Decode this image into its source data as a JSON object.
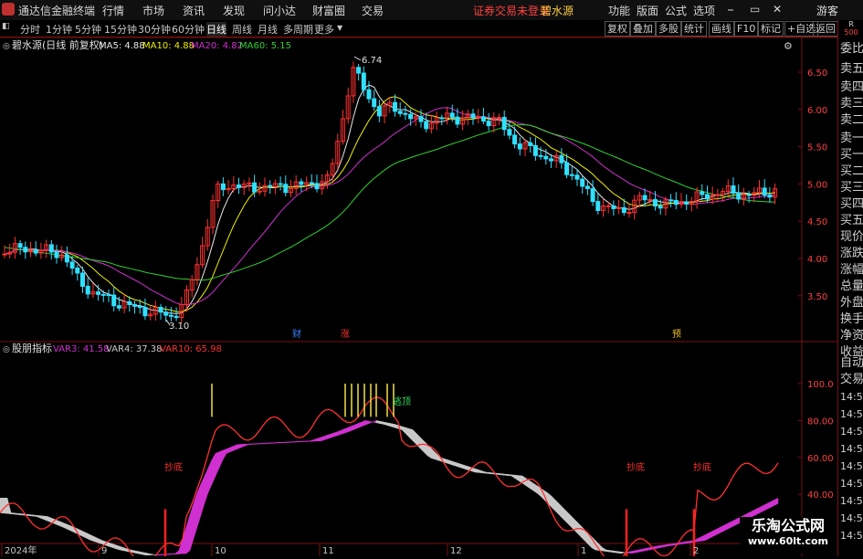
{
  "menubar": {
    "app_title": "通达信金融终端",
    "menus": [
      "行情",
      "市场",
      "资讯",
      "发现",
      "问小达",
      "财富圈",
      "交易"
    ],
    "notice": "证券交易未登录",
    "stock_name": "碧水源",
    "right_menus": [
      "功能",
      "版面",
      "公式",
      "选项"
    ],
    "window_controls": [
      "minimize-icon",
      "restore-icon",
      "close-icon"
    ],
    "guest_label": "游客"
  },
  "toolbar": {
    "periods": [
      "分时",
      "1分钟",
      "5分钟",
      "15分钟",
      "30分钟",
      "60分钟",
      "日线",
      "周线",
      "月线",
      "多周期",
      "更多"
    ],
    "active_period": "日线",
    "right_buttons": [
      "复权",
      "叠加",
      "多股",
      "统计",
      "画线",
      "F10",
      "标记",
      "+自选",
      "返回"
    ]
  },
  "side_panel": {
    "badge_top": "R",
    "badge_num": "500",
    "labels": [
      "委比",
      "卖五",
      "卖四",
      "卖三",
      "卖二",
      "卖一",
      "买一",
      "买二",
      "买三",
      "买四",
      "买五",
      "现价",
      "涨跌",
      "涨幅",
      "总量",
      "外盘",
      "换手",
      "净资",
      "收益"
    ],
    "lower_labels": [
      "自动",
      "交易"
    ],
    "times": [
      "14:5",
      "14:5",
      "14:5",
      "14:5",
      "14:5",
      "14:5",
      "14:5",
      "14:5",
      "14:5"
    ]
  },
  "price_chart": {
    "title": "碧水源(日线 前复权)",
    "indicators": [
      {
        "label": "MA5: 4.88",
        "color": "#e8e8e8"
      },
      {
        "label": "MA10: 4.88",
        "color": "#f0f000"
      },
      {
        "label": "MA20: 4.82",
        "color": "#d030d0"
      },
      {
        "label": "MA60: 5.15",
        "color": "#30d030"
      }
    ],
    "y_ticks": [
      "6.50",
      "6.00",
      "5.50",
      "5.00",
      "4.50",
      "4.00",
      "3.50"
    ],
    "high_label": "6.74",
    "low_label": "3.10",
    "event_marks": [
      {
        "text": "财",
        "color": "#4080ff"
      },
      {
        "text": "涨",
        "color": "#ff3030"
      },
      {
        "text": "预",
        "color": "#f0c020"
      }
    ]
  },
  "indicator_chart": {
    "title": "股朋指标",
    "values": [
      {
        "label": "VAR3: 41.58",
        "color": "#d030d0"
      },
      {
        "label": "VAR4: 37.38",
        "color": "#c8c8c8"
      },
      {
        "label": "VAR10: 65.98",
        "color": "#ff3030"
      }
    ],
    "y_ticks": [
      "100.0",
      "80.00",
      "60.00",
      "40.00",
      "20.00"
    ],
    "signals": [
      {
        "text": "抄底"
      },
      {
        "text": "逃顶"
      },
      {
        "text": "抄底"
      },
      {
        "text": "抄底"
      }
    ]
  },
  "x_axis": {
    "labels": [
      "2024年",
      "9",
      "10",
      "11",
      "12",
      "1",
      "2"
    ]
  },
  "watermark": {
    "line1": "乐淘公式网",
    "line2": "www.60lt.com"
  },
  "colors": {
    "up": "#ff3030",
    "down": "#30e0ff",
    "ma5": "#e8e8e8",
    "ma10": "#f0f000",
    "ma20": "#d030d0",
    "ma60": "#30d030"
  }
}
